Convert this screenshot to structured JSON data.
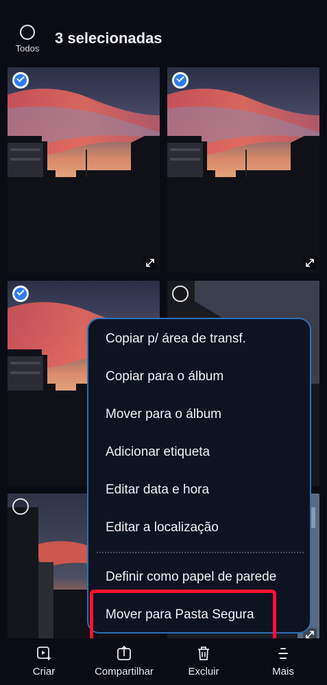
{
  "header": {
    "select_all_label": "Todos",
    "title": "3 selecionadas"
  },
  "grid": [
    {
      "selected": true
    },
    {
      "selected": true
    },
    {
      "selected": true
    },
    {
      "selected": false
    },
    {
      "selected": false
    },
    {
      "selected": false
    }
  ],
  "menu": {
    "items": [
      "Copiar p/ área de transf.",
      "Copiar para o álbum",
      "Mover para o álbum",
      "Adicionar etiqueta",
      "Editar data e hora",
      "Editar a localização",
      "Definir como papel de parede",
      "Mover para Pasta Segura"
    ],
    "highlighted_item": "Mover para Pasta Segura",
    "highlight_color": "#ff1230"
  },
  "bottom_bar": {
    "items": [
      {
        "label": "Criar",
        "icon": "create-icon"
      },
      {
        "label": "Compartilhar",
        "icon": "share-icon"
      },
      {
        "label": "Excluir",
        "icon": "trash-icon"
      },
      {
        "label": "Mais",
        "icon": "more-icon"
      }
    ]
  },
  "colors": {
    "accent": "#2f7bf0",
    "menu_border": "#2d71b4",
    "background": "#0a0c14"
  }
}
